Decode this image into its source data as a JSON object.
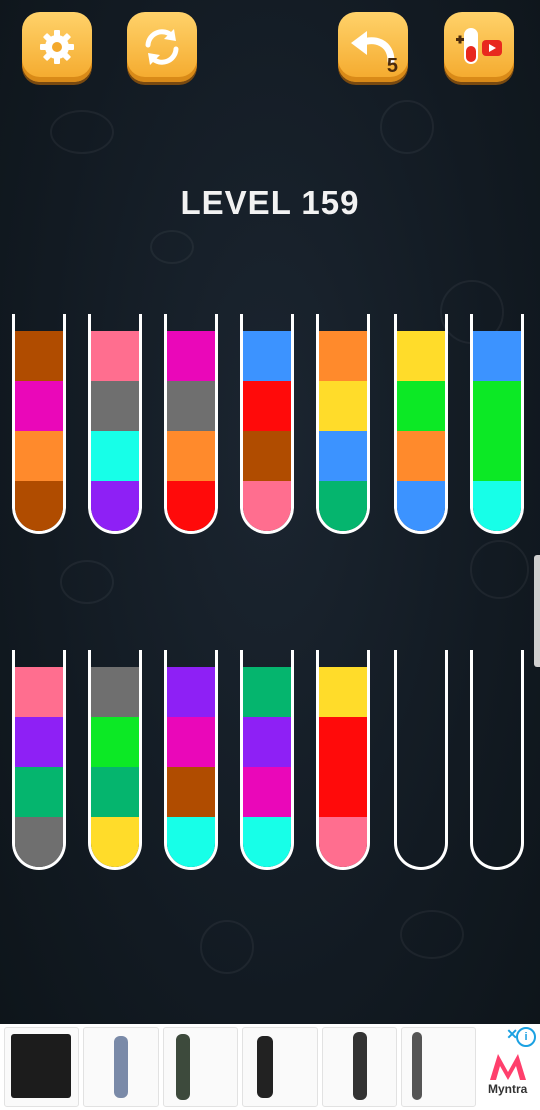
{
  "game": {
    "level_title": "LEVEL 159",
    "undo_count": "5"
  },
  "buttons": [
    {
      "name": "settings-button",
      "icon": "gear-icon"
    },
    {
      "name": "restart-button",
      "icon": "refresh-icon"
    },
    {
      "name": "undo-button",
      "icon": "undo-arrow-icon"
    },
    {
      "name": "add-tube-button",
      "icon": "test-tube-video-icon"
    }
  ],
  "colors": {
    "brown": "#b04c00",
    "magenta": "#ea07b9",
    "orange": "#ff8a2c",
    "pink": "#ff6e8f",
    "gray": "#6f6f6f",
    "cyan": "#17ffe8",
    "purple": "#8e20f5",
    "red": "#ff0a0a",
    "blue": "#3c93ff",
    "yellow": "#ffdc2a",
    "green": "#0ce925",
    "teal": "#05b56e"
  },
  "tubes_row1": [
    [
      "brown",
      "orange",
      "magenta",
      "brown"
    ],
    [
      "purple",
      "cyan",
      "gray",
      "pink"
    ],
    [
      "red",
      "orange",
      "gray",
      "magenta"
    ],
    [
      "pink",
      "brown",
      "red",
      "blue"
    ],
    [
      "teal",
      "blue",
      "yellow",
      "orange"
    ],
    [
      "blue",
      "orange",
      "green",
      "yellow"
    ],
    [
      "cyan",
      "green",
      "green",
      "blue"
    ]
  ],
  "tubes_row2": [
    [
      "gray",
      "teal",
      "purple",
      "pink"
    ],
    [
      "yellow",
      "teal",
      "green",
      "gray"
    ],
    [
      "cyan",
      "brown",
      "magenta",
      "purple"
    ],
    [
      "cyan",
      "magenta",
      "purple",
      "teal"
    ],
    [
      "pink",
      "red",
      "red",
      "yellow"
    ],
    [],
    []
  ],
  "ad": {
    "brand": "Myntra",
    "info_icon": "info-icon",
    "close_icon": "close-icon"
  }
}
